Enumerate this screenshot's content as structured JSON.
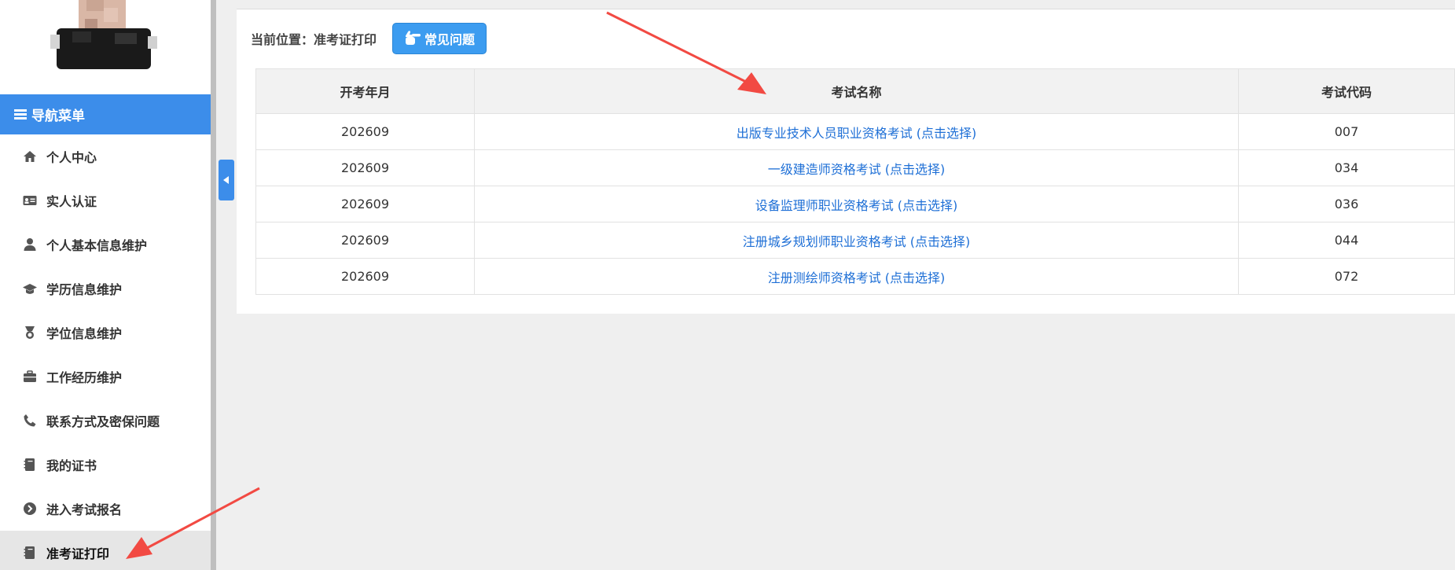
{
  "sidebar": {
    "nav_header": "导航菜单",
    "items": [
      {
        "label": "个人中心",
        "icon": "home-icon"
      },
      {
        "label": "实人认证",
        "icon": "id-card-icon"
      },
      {
        "label": "个人基本信息维护",
        "icon": "user-icon"
      },
      {
        "label": "学历信息维护",
        "icon": "graduation-cap-icon"
      },
      {
        "label": "学位信息维护",
        "icon": "medal-icon"
      },
      {
        "label": "工作经历维护",
        "icon": "briefcase-icon"
      },
      {
        "label": "联系方式及密保问题",
        "icon": "phone-icon"
      },
      {
        "label": "我的证书",
        "icon": "book-icon"
      },
      {
        "label": "进入考试报名",
        "icon": "chevron-circle-right-icon"
      },
      {
        "label": "准考证打印",
        "icon": "book-icon"
      }
    ],
    "active_index": 9
  },
  "breadcrumb": {
    "text": "当前位置：准考证打印",
    "faq_label": "常见问题"
  },
  "table": {
    "headers": [
      "开考年月",
      "考试名称",
      "考试代码"
    ],
    "rows": [
      {
        "month": "202609",
        "name": "出版专业技术人员职业资格考试 (点击选择)",
        "code": "007"
      },
      {
        "month": "202609",
        "name": "一级建造师资格考试 (点击选择)",
        "code": "034"
      },
      {
        "month": "202609",
        "name": "设备监理师职业资格考试 (点击选择)",
        "code": "036"
      },
      {
        "month": "202609",
        "name": "注册城乡规划师职业资格考试 (点击选择)",
        "code": "044"
      },
      {
        "month": "202609",
        "name": "注册测绘师资格考试 (点击选择)",
        "code": "072"
      }
    ]
  },
  "colors": {
    "accent": "#3c8dea",
    "link": "#1e6fd6",
    "annotation_arrow": "#f24a43"
  }
}
